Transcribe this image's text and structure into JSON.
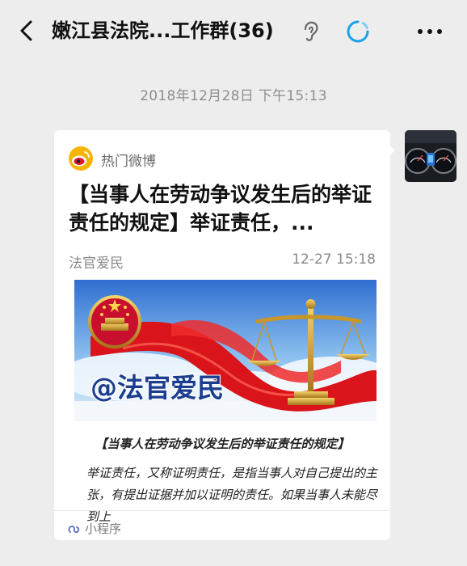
{
  "header": {
    "title": "嫩江县法院...工作群(36)"
  },
  "chat": {
    "timestamp": "2018年12月28日 下午15:13"
  },
  "message": {
    "source_label": "热门微博",
    "headline": "【当事人在劳动争议发生后的举证责任的规定】举证责任，...",
    "author": "法官爱民",
    "date": "12-27 15:18",
    "banner_text": "@法官爱民",
    "doc_title": "【当事人在劳动争议发生后的举证责任的规定】",
    "doc_body": "举证责任，又称证明责任，是指当事人对自己提出的主张，有提出证据并加以证明的责任。如果当事人未能尽到上",
    "footer_label": "小程序"
  },
  "icons": {
    "back": "chevron-left-icon",
    "ear": "ear-icon",
    "ring": "refresh-ring-icon",
    "more": "more-dots-icon",
    "weibo": "weibo-logo-icon",
    "link": "mini-program-link-icon"
  },
  "colors": {
    "background": "#ededed",
    "card": "#ffffff",
    "ring_accent": "#1aa3e8",
    "banner_red": "#d9141a",
    "banner_blue": "#1b3d8f"
  }
}
